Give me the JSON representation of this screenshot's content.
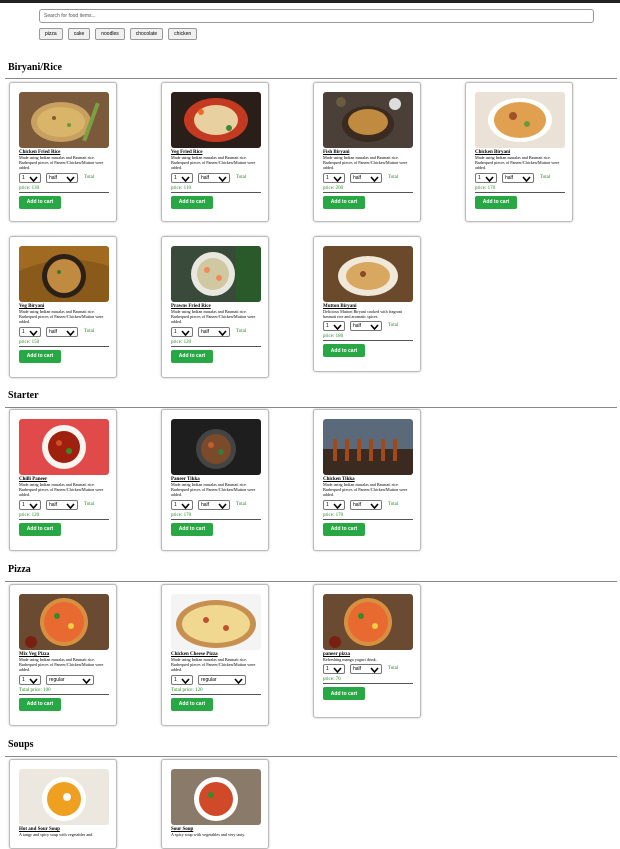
{
  "search": {
    "placeholder": "Search for food items..."
  },
  "tags": [
    "pizza",
    "cake",
    "noodles",
    "chocolate",
    "chicken"
  ],
  "sections": {
    "biryani": "Biryani/Rice",
    "starter": "Starter",
    "pizza": "Pizza",
    "soups": "Soups"
  },
  "common": {
    "add_to_cart": "Add to cart",
    "total": "Total",
    "desc_default": "Made using Indian masalas and Basmati rice. Barbequed pieces of Paneer/Chicken/Mutton were added."
  },
  "items": [
    {
      "name": "Chicken Fried Rice",
      "qty": "1",
      "size": "half",
      "price": "price: 130"
    },
    {
      "name": "Veg Fried Rice",
      "qty": "1",
      "size": "half",
      "price": "price: 110"
    },
    {
      "name": "Fish Biryani",
      "qty": "1",
      "size": "half",
      "price": "price: 200"
    },
    {
      "name": "Chicken Biryani",
      "qty": "1",
      "size": "half",
      "price": "price: 170"
    },
    {
      "name": "Veg Biryani",
      "qty": "1",
      "size": "half",
      "price": "price: 150"
    },
    {
      "name": "Prawns Fried Rice",
      "qty": "1",
      "size": "half",
      "price": "price: 120"
    },
    {
      "name": "Mutton Biryani",
      "qty": "1",
      "size": "half",
      "price": "price: 180",
      "desc": "Delicious Mutton Biryani cooked with fragrant basmati rice and aromatic spices."
    },
    {
      "name": "Chilli Paneer",
      "qty": "1",
      "size": "half",
      "price": "price: 120"
    },
    {
      "name": "Paneer Tikka",
      "qty": "1",
      "size": "half",
      "price": "price: 170"
    },
    {
      "name": "Chicken Tikka",
      "qty": "1",
      "size": "half",
      "price": "price: 170"
    },
    {
      "name": "Mix Veg Pizza",
      "qty": "1",
      "size": "regular",
      "price": "Total price: 100"
    },
    {
      "name": "Chicken Cheese Pizza",
      "qty": "1",
      "size": "regular",
      "price": "Total price: 120"
    },
    {
      "name": "paneer pizza",
      "qty": "1",
      "size": "half",
      "price": "price: 70",
      "desc": "Refreshing mango yogurt drink."
    },
    {
      "name": "Hot and Sour Soup",
      "desc": "A tangy and spicy soup with vegetables and"
    },
    {
      "name": "Sour Soup",
      "desc": "A spicy soup with vegetables and very tasty."
    }
  ],
  "colors": {
    "button": "#28a745",
    "price": "#2a8a2a"
  }
}
